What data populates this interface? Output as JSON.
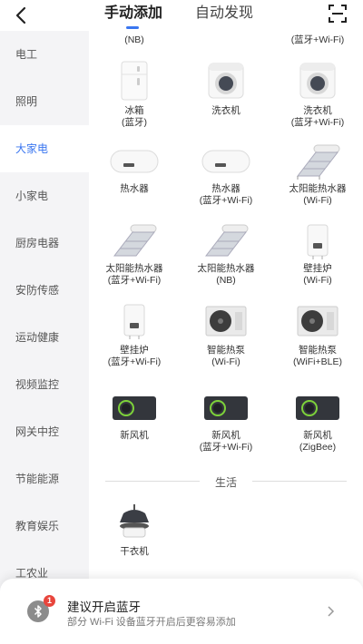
{
  "header": {
    "tabs": [
      {
        "label": "手动添加",
        "active": true
      },
      {
        "label": "自动发现",
        "active": false
      }
    ],
    "accent": "#3a76f0"
  },
  "sidebar": {
    "items": [
      {
        "label": "电工"
      },
      {
        "label": "照明"
      },
      {
        "label": "大家电",
        "active": true
      },
      {
        "label": "小家电"
      },
      {
        "label": "厨房电器"
      },
      {
        "label": "安防传感"
      },
      {
        "label": "运动健康"
      },
      {
        "label": "视频监控"
      },
      {
        "label": "网关中控"
      },
      {
        "label": "节能能源"
      },
      {
        "label": "教育娱乐"
      },
      {
        "label": "工农业"
      }
    ]
  },
  "products": {
    "top_partial": [
      "(NB)",
      "(蓝牙+Wi-Fi)"
    ],
    "items": [
      {
        "line1": "冰箱",
        "line2": "(蓝牙)",
        "icon": "fridge-icon"
      },
      {
        "line1": "洗衣机",
        "line2": "",
        "icon": "washer-icon"
      },
      {
        "line1": "洗衣机",
        "line2": "(蓝牙+Wi-Fi)",
        "icon": "washer-icon"
      },
      {
        "line1": "热水器",
        "line2": "",
        "icon": "water-heater-icon"
      },
      {
        "line1": "热水器",
        "line2": "(蓝牙+Wi-Fi)",
        "icon": "water-heater-icon"
      },
      {
        "line1": "太阳能热水器",
        "line2": "(Wi-Fi)",
        "icon": "solar-heater-icon"
      },
      {
        "line1": "太阳能热水器",
        "line2": "(蓝牙+Wi-Fi)",
        "icon": "solar-heater-icon"
      },
      {
        "line1": "太阳能热水器",
        "line2": "(NB)",
        "icon": "solar-heater-icon"
      },
      {
        "line1": "壁挂炉",
        "line2": "(Wi-Fi)",
        "icon": "boiler-icon"
      },
      {
        "line1": "壁挂炉",
        "line2": "(蓝牙+Wi-Fi)",
        "icon": "boiler-icon"
      },
      {
        "line1": "智能热泵",
        "line2": "(Wi-Fi)",
        "icon": "heat-pump-icon"
      },
      {
        "line1": "智能热泵",
        "line2": "(WiFi+BLE)",
        "icon": "heat-pump-icon"
      },
      {
        "line1": "新风机",
        "line2": "",
        "icon": "fresh-air-icon"
      },
      {
        "line1": "新风机",
        "line2": "(蓝牙+Wi-Fi)",
        "icon": "fresh-air-icon"
      },
      {
        "line1": "新风机",
        "line2": "(ZigBee)",
        "icon": "fresh-air-icon"
      }
    ]
  },
  "section_life": {
    "title": "生活",
    "items": [
      {
        "line1": "干衣机",
        "icon": "dryer-icon"
      }
    ]
  },
  "bluetooth_tip": {
    "badge": "1",
    "title": "建议开启蓝牙",
    "subtitle": "部分 Wi-Fi 设备蓝牙开启后更容易添加"
  }
}
